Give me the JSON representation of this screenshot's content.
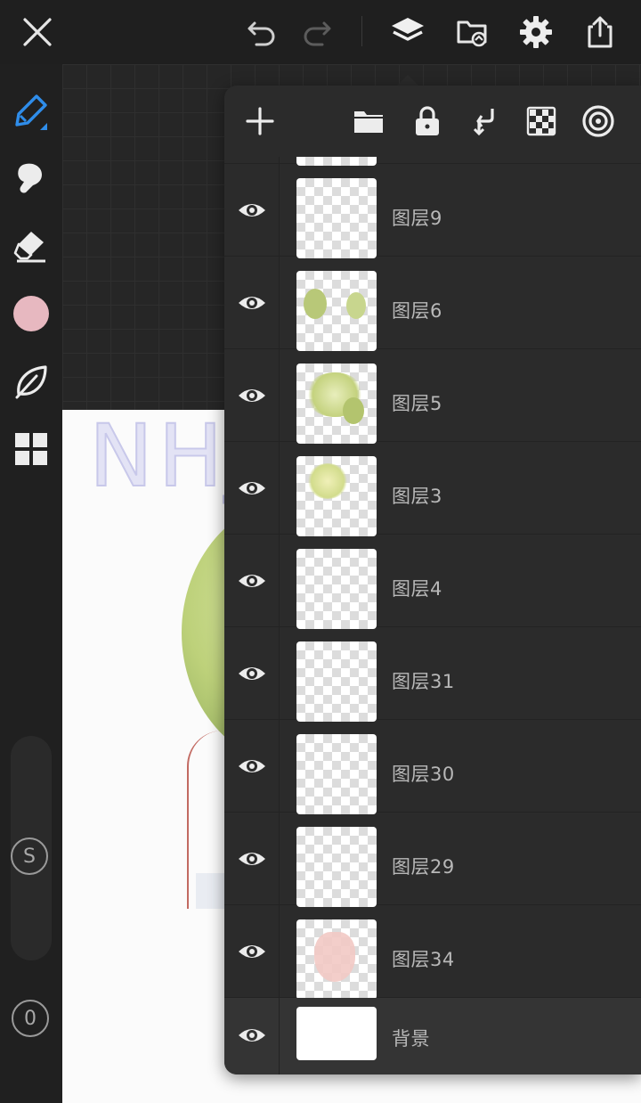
{
  "toolbar": {
    "close_icon": "close-icon",
    "undo_icon": "undo-icon",
    "redo_icon": "redo-icon",
    "layers_icon": "layers-icon",
    "gallery_icon": "gallery-icon",
    "settings_icon": "gear-icon",
    "share_icon": "share-icon"
  },
  "left_tools": [
    "brush-icon",
    "smudge-icon",
    "eraser-icon",
    "color-swatch",
    "leaf-icon",
    "grid-icon"
  ],
  "color_swatch": "#e7b8c0",
  "brush_size_label": "S",
  "opacity_label": "0",
  "canvas_text": "NHJ",
  "layer_panel": {
    "tools": [
      "add-layer-icon",
      "folder-icon",
      "lock-icon",
      "merge-down-icon",
      "transparency-icon",
      "reference-icon"
    ],
    "layers": [
      {
        "name": "图层9"
      },
      {
        "name": "图层6"
      },
      {
        "name": "图层5"
      },
      {
        "name": "图层3"
      },
      {
        "name": "图层4"
      },
      {
        "name": "图层31"
      },
      {
        "name": "图层30"
      },
      {
        "name": "图层29"
      },
      {
        "name": "图层34"
      }
    ],
    "background_layer": {
      "name": "背景"
    }
  }
}
